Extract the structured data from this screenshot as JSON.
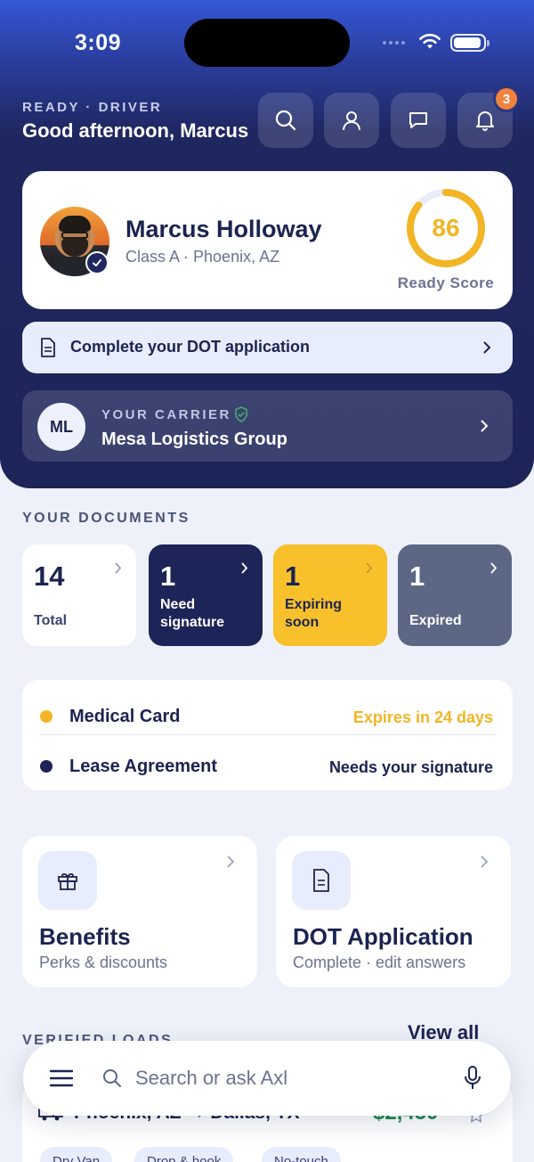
{
  "status_bar": {
    "time": "3:09"
  },
  "header": {
    "role": "READY · DRIVER",
    "greeting": "Good afternoon, Marcus",
    "notification_count": "3"
  },
  "profile": {
    "name": "Marcus Holloway",
    "subtitle": "Class A · Phoenix, AZ",
    "ready_score": 86,
    "ready_score_label": "Ready Score"
  },
  "dot_banner": {
    "text": "Complete your DOT application"
  },
  "carrier": {
    "initials": "ML",
    "label": "YOUR CARRIER",
    "name": "Mesa Logistics Group"
  },
  "documents": {
    "title": "YOUR DOCUMENTS",
    "tiles": [
      {
        "count": "14",
        "label": "Total"
      },
      {
        "count": "1",
        "label": "Need signature"
      },
      {
        "count": "1",
        "label": "Expiring soon"
      },
      {
        "count": "1",
        "label": "Expired"
      }
    ],
    "alerts": [
      {
        "name": "Medical Card",
        "status": "Expires in 24 days",
        "color": "#f2b526"
      },
      {
        "name": "Lease Agreement",
        "status": "Needs your signature",
        "color": "#1d2457"
      }
    ]
  },
  "cards": [
    {
      "title": "Benefits",
      "subtitle": "Perks & discounts",
      "icon": "gift-icon"
    },
    {
      "title": "DOT Application",
      "subtitle": "Complete · edit answers",
      "icon": "document-icon"
    }
  ],
  "verified_loads": {
    "title": "VERIFIED LOADS",
    "view_all": "View all",
    "first_load": {
      "route": "Phoenix, AZ → Dallas, TX",
      "price": "$2,450",
      "chips": [
        "Dry Van",
        "Drop & hook",
        "No-touch"
      ]
    }
  },
  "search": {
    "placeholder": "Search or ask Axl"
  },
  "colors": {
    "navy": "#1d2457",
    "accent_yellow": "#f2b526",
    "slate": "#5b6785",
    "badge_orange": "#f0823c",
    "success_green": "#1f8a4c"
  }
}
